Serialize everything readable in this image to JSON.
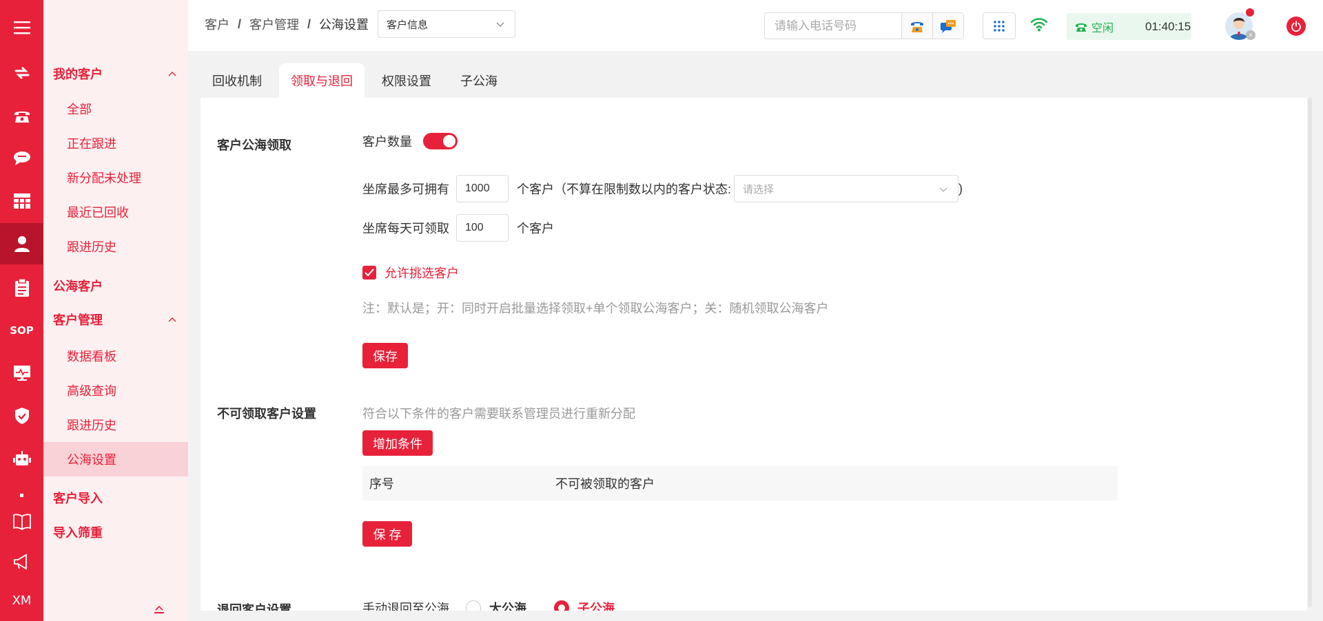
{
  "rail": {
    "sop": "SOP",
    "xm": "XM",
    "icons": [
      "swap-icon",
      "telephone-icon",
      "chat-icon",
      "table-icon",
      "user-icon",
      "clipboard-icon",
      "sop-icon",
      "monitor-icon",
      "shield-icon",
      "robot-icon",
      "dot-icon",
      "book-icon",
      "megaphone-icon",
      "xm-icon"
    ]
  },
  "submenu": {
    "my_customers": "我的客户",
    "my_items": [
      "全部",
      "正在跟进",
      "新分配未处理",
      "最近已回收",
      "跟进历史"
    ],
    "public_customers": "公海客户",
    "customer_mgmt": "客户管理",
    "mgmt_items": [
      "数据看板",
      "高级查询",
      "跟进历史",
      "公海设置"
    ],
    "customer_import": "客户导入",
    "import_dedup": "导入筛重"
  },
  "topbar": {
    "breadcrumb": [
      "客户",
      "客户管理",
      "公海设置"
    ],
    "crumb_select": "客户信息",
    "phone_placeholder": "请输入电话号码",
    "status_label": "空闲",
    "status_time": "01:40:15"
  },
  "tabs": [
    "回收机制",
    "领取与退回",
    "权限设置",
    "子公海"
  ],
  "claim": {
    "title": "客户公海领取",
    "count_label": "客户数量",
    "max_prefix": "坐席最多可拥有",
    "max_value": "1000",
    "max_suffix": "个客户（不算在限制数以内的客户状态:",
    "status_placeholder": "请选择",
    "close_paren": ")",
    "daily_prefix": "坐席每天可领取",
    "daily_value": "100",
    "daily_suffix": "个客户",
    "allow_pick": "允许挑选客户",
    "note": "注：默认是；开：同时开启批量选择领取+单个领取公海客户；关：随机领取公海客户",
    "save": "保存"
  },
  "unclaimable": {
    "title": "不可领取客户设置",
    "desc": "符合以下条件的客户需要联系管理员进行重新分配",
    "add": "增加条件",
    "col_index": "序号",
    "col_customer": "不可被领取的客户",
    "save": "保 存"
  },
  "returns": {
    "title": "退回客户设置",
    "manual": "手动退回至公海",
    "opt_big": "大公海",
    "opt_sub": "子公海"
  },
  "colors": {
    "accent": "#e8213a",
    "status_green": "#1fb14e"
  }
}
